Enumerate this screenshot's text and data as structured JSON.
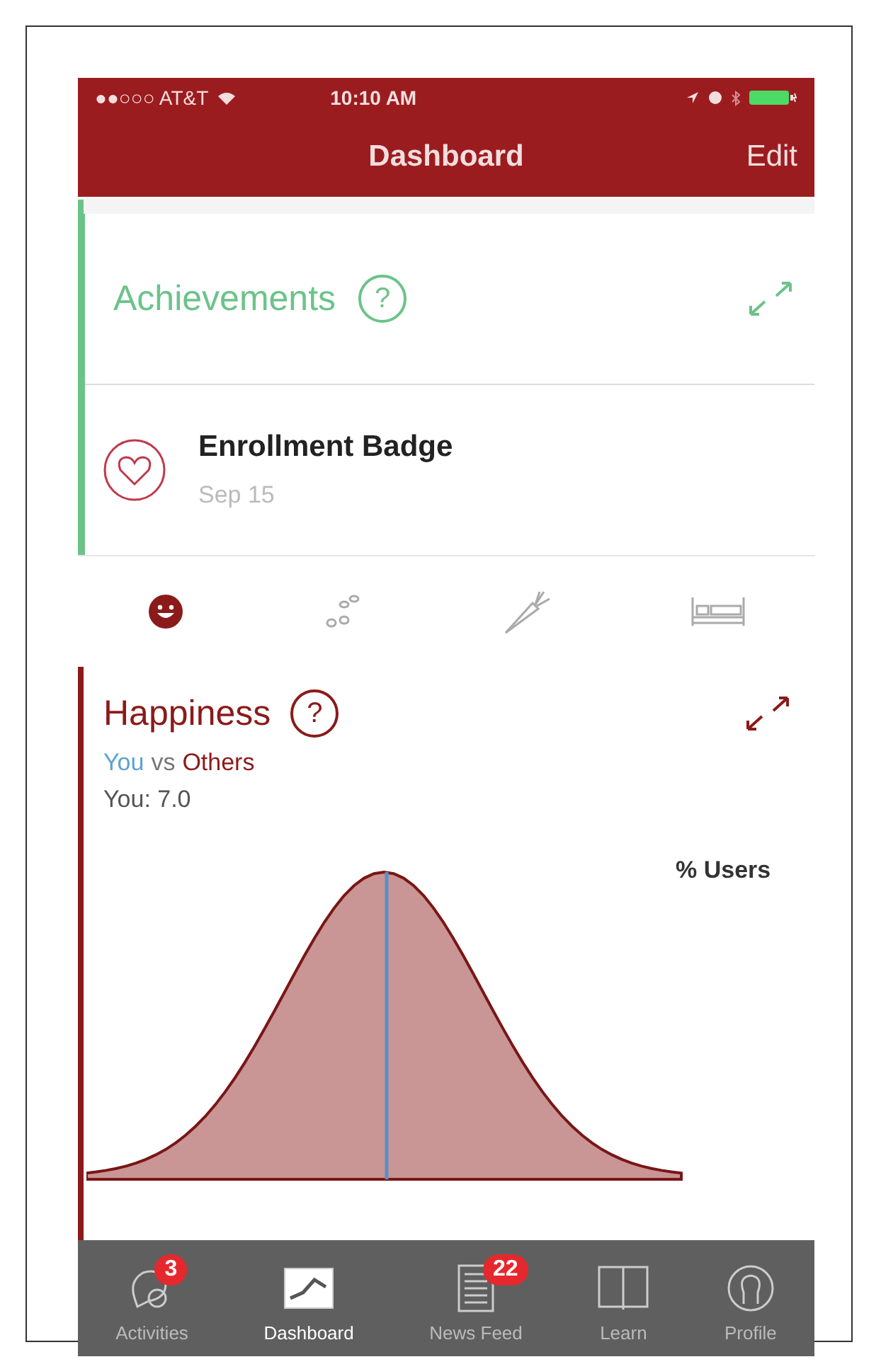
{
  "status_bar": {
    "carrier": "●●○○○ AT&T",
    "time": "10:10 AM"
  },
  "nav_bar": {
    "title": "Dashboard",
    "action": "Edit"
  },
  "achievements": {
    "title": "Achievements",
    "help": "?",
    "items": [
      {
        "title": "Enrollment Badge",
        "date": "Sep 15"
      }
    ]
  },
  "categories": [
    {
      "kind": "happiness",
      "selected": true
    },
    {
      "kind": "activity",
      "selected": false
    },
    {
      "kind": "nutrition",
      "selected": false
    },
    {
      "kind": "sleep",
      "selected": false
    }
  ],
  "happiness": {
    "title": "Happiness",
    "help": "?",
    "legend_you": "You",
    "legend_vs": "vs",
    "legend_others": "Others",
    "your_score": "You: 7.0",
    "axis_label": "% Users"
  },
  "tab_bar": [
    {
      "label": "Activities",
      "kind": "activities",
      "badge": "3",
      "selected": false
    },
    {
      "label": "Dashboard",
      "kind": "dashboard",
      "selected": true
    },
    {
      "label": "News Feed",
      "kind": "news",
      "badge": "22",
      "selected": false
    },
    {
      "label": "Learn",
      "kind": "learn",
      "selected": false
    },
    {
      "label": "Profile",
      "kind": "profile",
      "selected": false
    }
  ]
}
